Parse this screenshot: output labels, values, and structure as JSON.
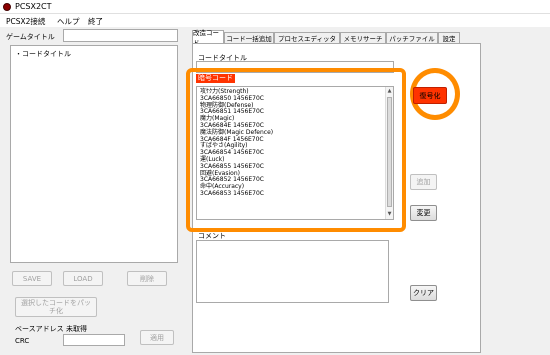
{
  "window": {
    "title": "PCSX2CT"
  },
  "menu": [
    {
      "label": "PCSX2接続"
    },
    {
      "label": "ヘルプ"
    },
    {
      "label": "終了"
    }
  ],
  "left": {
    "game_title_label": "ゲームタイトル",
    "game_title_value": "",
    "tree_root": "・コードタイトル",
    "save_label": "SAVE",
    "load_label": "LOAD",
    "delete_label": "削除",
    "batch_button_label": "選択したコードをパッチ化",
    "base_address_label": "ベースアドレス",
    "base_address_value": "未取得",
    "crc_label": "CRC",
    "crc_value": "",
    "apply_label": "適用"
  },
  "tabs": [
    {
      "label": "改造コード",
      "active": true
    },
    {
      "label": "コード一括追加",
      "active": false
    },
    {
      "label": "プロセスエディッタ",
      "active": false
    },
    {
      "label": "メモリサーチ",
      "active": false
    },
    {
      "label": "パッチファイル",
      "active": false
    },
    {
      "label": "設定",
      "active": false
    }
  ],
  "main": {
    "code_title_label": "コードタイトル",
    "code_title_value": "",
    "cipher_code_label": "暗号コード",
    "code_lines": [
      "攻ｹｸ力(Strength)",
      "3CA66850 1456E70C",
      "物理防御(Defense)",
      "3CA66851 1456E70C",
      "魔力(Magic)",
      "3CA6684E 1456E70C",
      "魔法防御(Magic Defence)",
      "3CA6684F 1456E70C",
      "すばやさ(Agility)",
      "3CA66854 1456E70C",
      "運(Luck)",
      "3CA66855 1456E70C",
      "回避(Evasion)",
      "3CA66852 1456E70C",
      "命中(Accuracy)",
      "3CA66853 1456E70C"
    ],
    "comment_label": "コメント",
    "comment_value": "",
    "encrypt_label": "復号化",
    "add_label": "追加",
    "change_label": "変更",
    "clear_label": "クリア"
  },
  "colors": {
    "highlight_orange": "#ff8c00",
    "label_red": "#ff3300"
  }
}
